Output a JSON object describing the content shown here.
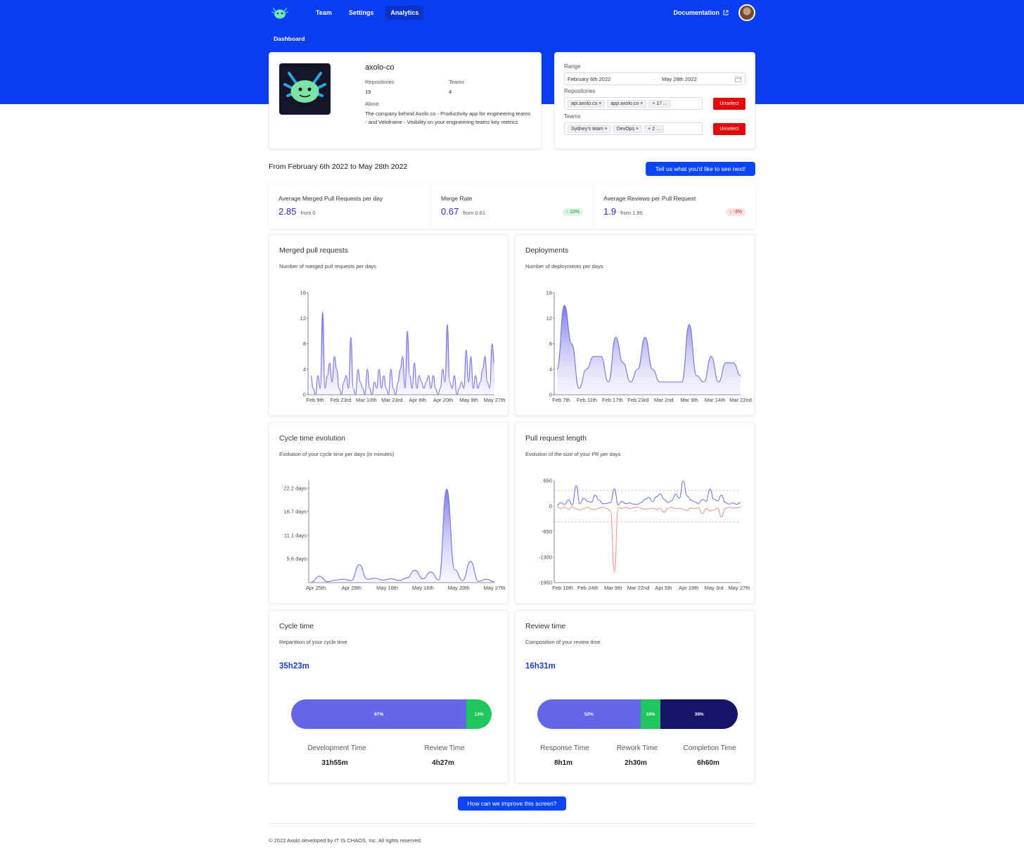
{
  "nav": {
    "logo_icon": "axolotl-logo-icon",
    "links": [
      "Team",
      "Settings",
      "Analytics"
    ],
    "active": "Analytics",
    "documentation": "Documentation"
  },
  "breadcrumb": "Dashboard",
  "org": {
    "name": "axolo-co",
    "repositories_label": "Repositories",
    "repositories": "19",
    "teams_label": "Teams",
    "teams": "4",
    "about_label": "About",
    "about": "The company behind Axolo.co - Productivity app for engineering teams - and Veloframe - Visibility on your engineering teams key metrics"
  },
  "filters": {
    "range_label": "Range",
    "range_start": "February 6th 2022",
    "range_sep": "→",
    "range_end": "May 28th 2022",
    "repositories_label": "Repositories",
    "repositories": [
      "api.axolo.co",
      "app.axolo.co"
    ],
    "repositories_more": "+ 17 ...",
    "teams_label": "Teams",
    "teams": [
      "Sydney's team",
      "DevOps"
    ],
    "teams_more": "+ 2 ...",
    "unselect": "Unselect"
  },
  "period": "From February 6th 2022 to May 28th 2022",
  "feedback_button": "Tell us what you'd like to see next!",
  "stats": [
    {
      "title": "Average Merged Pull Requests per day",
      "value": "2.85",
      "from": "from 0",
      "badge": ""
    },
    {
      "title": "Merge Rate",
      "value": "0.67",
      "from": "from 0.61",
      "badge": "↑ 10%",
      "badge_type": "up"
    },
    {
      "title": "Average Reviews per Pull Request",
      "value": "1.9",
      "from": "from 1.95",
      "badge": "↓ -3%",
      "badge_type": "down"
    }
  ],
  "charts": {
    "merged": {
      "title": "Merged pull requests",
      "subtitle": "Number of merged pull requests per days"
    },
    "deployments": {
      "title": "Deployments",
      "subtitle": "Number of deployments per days"
    },
    "cycle_evo": {
      "title": "Cycle time evolution",
      "subtitle": "Evolution of your cycle time per days (in minutes)"
    },
    "pr_length": {
      "title": "Pull request length",
      "subtitle": "Evolution of the size of your PR per days"
    }
  },
  "chart_data": [
    {
      "type": "area",
      "id": "merged",
      "ylim": [
        0,
        16
      ],
      "yticks": [
        "0",
        "4",
        "8",
        "12",
        "16"
      ],
      "xticks": [
        "Feb 9th",
        "Feb 23rd",
        "Mar 10th",
        "Mar 23rd",
        "Apr 6th",
        "Apr 20th",
        "May 9th",
        "May 27th"
      ],
      "values": [
        3,
        1,
        0,
        3,
        1,
        13,
        1,
        3,
        5,
        2,
        6,
        4,
        1,
        0,
        2,
        3,
        1,
        9,
        1,
        0,
        4,
        2,
        1,
        0,
        4,
        1,
        0,
        2,
        1,
        4,
        1,
        3,
        1,
        0,
        4,
        1,
        0,
        2,
        4,
        6,
        1,
        10,
        3,
        1,
        5,
        1,
        3,
        2,
        1,
        2,
        3,
        1,
        3,
        1,
        0,
        1,
        4,
        2,
        11,
        2,
        1,
        3,
        0,
        1,
        2,
        1,
        7,
        2,
        6,
        1,
        3,
        1,
        2,
        4,
        6,
        2,
        1,
        8,
        5
      ]
    },
    {
      "type": "area",
      "id": "deployments",
      "ylim": [
        0,
        16
      ],
      "yticks": [
        "0",
        "4",
        "8",
        "12",
        "16"
      ],
      "xticks": [
        "Feb 7th",
        "Feb 11th",
        "Feb 17th",
        "Feb 23rd",
        "Mar 2nd",
        "Mar 9th",
        "Mar 14th",
        "Mar 22nd"
      ],
      "values": [
        4,
        14,
        8,
        1,
        4,
        6,
        6,
        2,
        9,
        5,
        2,
        4,
        9,
        4,
        2,
        2,
        2,
        2,
        11,
        3,
        2,
        6,
        2,
        5,
        5,
        3
      ]
    },
    {
      "type": "area",
      "id": "cycle_evo",
      "yticks": [
        "5.6 days",
        "11.1 days",
        "16.7 days",
        "22.2 days"
      ],
      "xticks": [
        "Apr 25th",
        "Apr 29th",
        "May 10th",
        "May 16th",
        "May 20th",
        "May 27th"
      ],
      "values": [
        0.2,
        1.5,
        0.2,
        0.6,
        0.8,
        0.5,
        4.2,
        0.8,
        1.0,
        0.6,
        0.9,
        0.5,
        1.1,
        2.9,
        0.9,
        2.5,
        0.6,
        22,
        3,
        0.5,
        5,
        0.3,
        0.8,
        0.2
      ],
      "ymax": 22.2
    },
    {
      "type": "line",
      "id": "pr_length",
      "ylim": [
        -1950,
        650
      ],
      "yticks": [
        "650",
        "0",
        "-650",
        "-1300",
        "-1950"
      ],
      "xticks": [
        "Feb 10th",
        "Feb 24th",
        "Mar 9th",
        "Mar 22nd",
        "Apr 5th",
        "Apr 19th",
        "May 3rd",
        "May 27th"
      ],
      "series": [
        {
          "name": "additions",
          "values": [
            20,
            80,
            40,
            160,
            30,
            520,
            60,
            200,
            120,
            100,
            280,
            150,
            60,
            70,
            90,
            440,
            30,
            120,
            60,
            80,
            50,
            40,
            90,
            170,
            220,
            110,
            240,
            310,
            170,
            90,
            140,
            300,
            200,
            640,
            260,
            150,
            110,
            60,
            170,
            120,
            430,
            170,
            130,
            280,
            90,
            50,
            80,
            40,
            90
          ]
        },
        {
          "name": "deletions",
          "values": [
            -20,
            -60,
            -30,
            -80,
            -20,
            -70,
            -100,
            -60,
            -30,
            -80,
            -90,
            -50,
            -30,
            -60,
            -120,
            -1680,
            -40,
            -60,
            -30,
            -70,
            -40,
            -30,
            -60,
            -80,
            -70,
            -50,
            -90,
            -60,
            -160,
            -60,
            -30,
            -70,
            -60,
            -80,
            -110,
            -50,
            -60,
            -40,
            -200,
            -60,
            -120,
            -100,
            -50,
            -280,
            -60,
            -30,
            -50,
            -40,
            -30
          ]
        }
      ],
      "reference_lines": [
        400,
        -400
      ]
    }
  ],
  "cycle_time": {
    "title": "Cycle time",
    "subtitle": "Repartition of your cycle time",
    "total": "35h23m",
    "segments": [
      {
        "pct": "87%",
        "label": "Development Time",
        "value": "31h55m",
        "color": "#6366e8"
      },
      {
        "pct": "13%",
        "label": "Review Time",
        "value": "4h27m",
        "color": "#21c55d"
      }
    ]
  },
  "review_time": {
    "title": "Review time",
    "subtitle": "Composition of your review time",
    "total": "16h31m",
    "segments": [
      {
        "pct": "52%",
        "label": "Response Time",
        "value": "8h1m",
        "color": "#6366e8"
      },
      {
        "pct": "10%",
        "label": "Rework Time",
        "value": "2h30m",
        "color": "#21c55d"
      },
      {
        "pct": "39%",
        "label": "Completion Time",
        "value": "6h60m",
        "color": "#13146a"
      }
    ]
  },
  "improve_button": "How can we improve this screen?",
  "footer": "© 2022 Axolo developed by IT IS CHAOS, Inc. All rights reserved."
}
